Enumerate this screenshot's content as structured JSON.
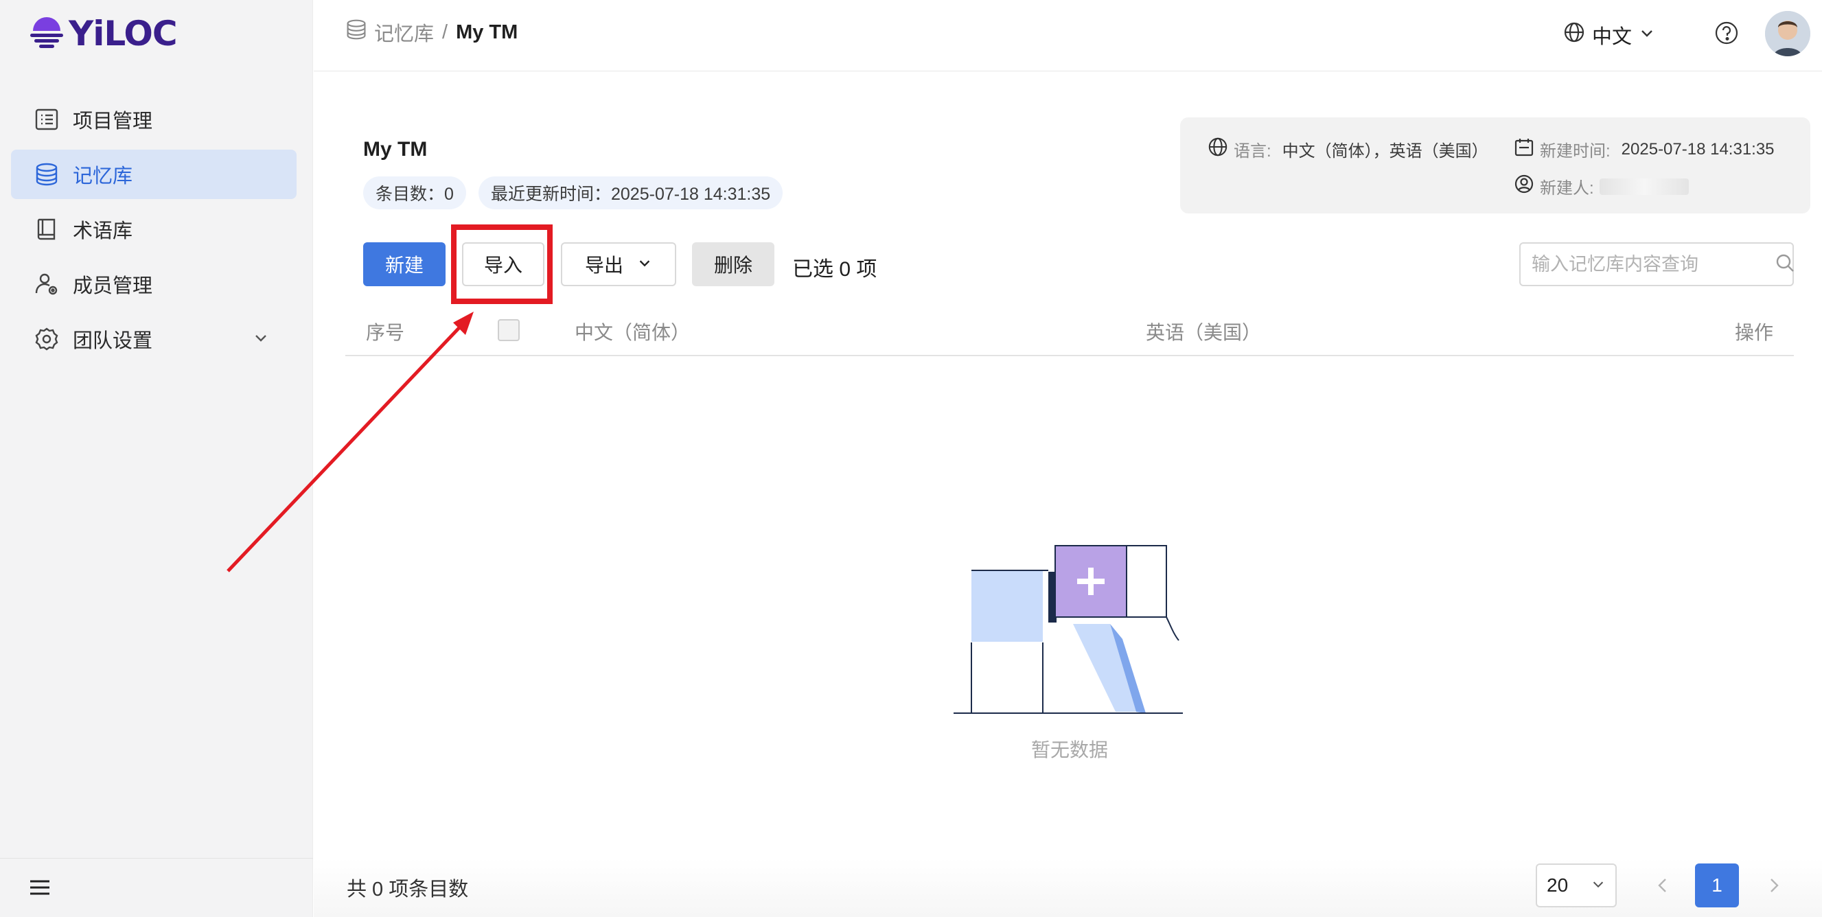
{
  "brand": {
    "name": "YiLOC",
    "color": "#3a1f8c",
    "accent": "#7a3fe0"
  },
  "sidebar": {
    "items": [
      {
        "label": "项目管理",
        "icon": "project-list-icon",
        "active": false
      },
      {
        "label": "记忆库",
        "icon": "database-icon",
        "active": true
      },
      {
        "label": "术语库",
        "icon": "book-icon",
        "active": false
      },
      {
        "label": "成员管理",
        "icon": "user-gear-icon",
        "active": false
      },
      {
        "label": "团队设置",
        "icon": "gear-icon",
        "active": false,
        "expandable": true
      }
    ]
  },
  "header": {
    "breadcrumb": {
      "parent": "记忆库",
      "separator": "/",
      "current": "My TM"
    },
    "language": "中文"
  },
  "main": {
    "title": "My TM",
    "entry_count": "条目数：0",
    "last_updated": "最近更新时间：2025-07-18 14:31:35",
    "info": {
      "lang_label": "语言:",
      "lang_value": "中文（简体），英语（美国）",
      "created_label": "新建时间:",
      "created_value": "2025-07-18 14:31:35",
      "creator_label": "新建人:"
    },
    "toolbar": {
      "new_label": "新建",
      "import_label": "导入",
      "export_label": "导出",
      "delete_label": "删除",
      "selected_text": "已选 0 项"
    },
    "search_placeholder": "输入记忆库内容查询",
    "table": {
      "columns": [
        "序号",
        "中文（简体）",
        "英语（美国）",
        "操作"
      ]
    },
    "empty_text": "暂无数据"
  },
  "footer": {
    "total_text": "共 0 项条目数",
    "page_size": "20",
    "current_page": "1"
  },
  "colors": {
    "primary": "#3f78e0",
    "highlight": "#e31b23",
    "active_bg": "#d9e4f7"
  }
}
